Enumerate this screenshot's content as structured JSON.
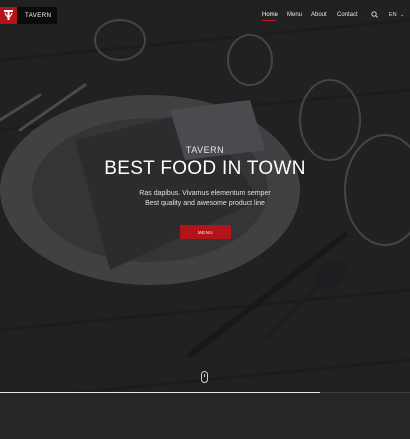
{
  "brand": {
    "name": "TAVERN",
    "accent": "#b3141b"
  },
  "nav": {
    "items": [
      {
        "label": "Home",
        "active": true
      },
      {
        "label": "Menu",
        "active": false
      },
      {
        "label": "About",
        "active": false
      },
      {
        "label": "Contact",
        "active": false
      }
    ],
    "search_icon": "search-icon",
    "language": "EN"
  },
  "hero": {
    "kicker": "TAVERN",
    "headline": "BEST FOOD IN TOWN",
    "line1": "Ras dapibus. Vivamus elementum semper",
    "line2": "Best quality and awesome product line",
    "cta_label": "MENU",
    "scroll_icon": "mouse-scroll-icon",
    "slide_progress": 0.78
  }
}
